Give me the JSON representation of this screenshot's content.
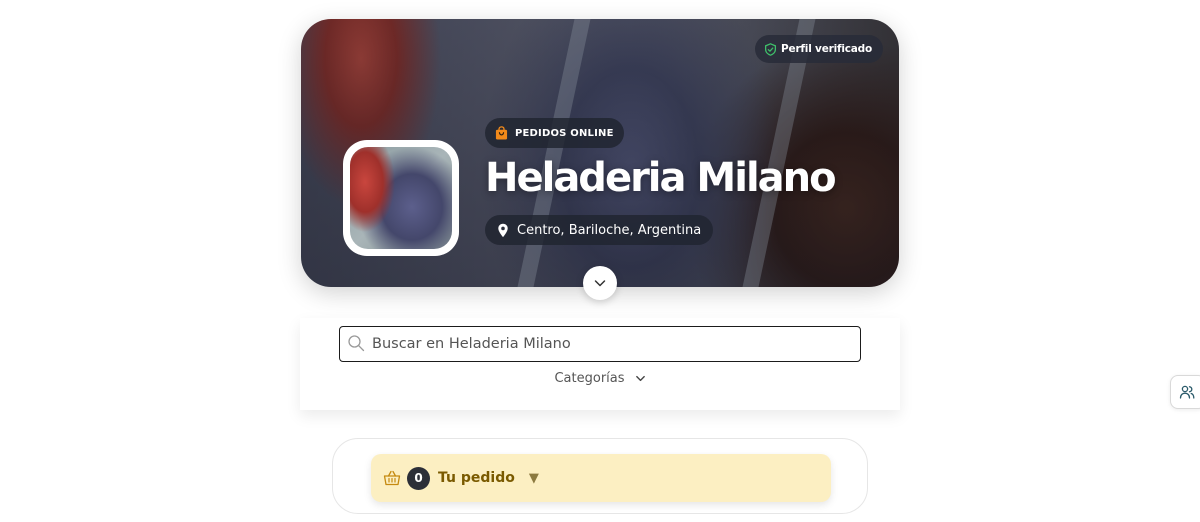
{
  "hero": {
    "verified_label": "Perfil verificado",
    "online_badge": "PEDIDOS ONLINE",
    "shop_name": "Heladeria Milano",
    "location": "Centro, Bariloche, Argentina"
  },
  "search": {
    "placeholder": "Buscar en Heladeria Milano",
    "value": ""
  },
  "categories_label": "Categorías",
  "order": {
    "count": "0",
    "label": "Tu pedido",
    "caret": "▼"
  },
  "icons": {
    "verified": "shield-check-icon",
    "bag": "shopping-bag-icon",
    "location": "map-pin-icon",
    "expand": "chevron-down-icon",
    "search": "search-icon",
    "categories": "chevron-down-icon",
    "basket": "basket-icon",
    "side": "users-icon"
  },
  "colors": {
    "order_pill": "#fcefc2",
    "order_text": "#7a5a00",
    "badge_bg": "#202430",
    "bag_orange": "#f28a1a",
    "verified_green": "#3fbf6a"
  }
}
